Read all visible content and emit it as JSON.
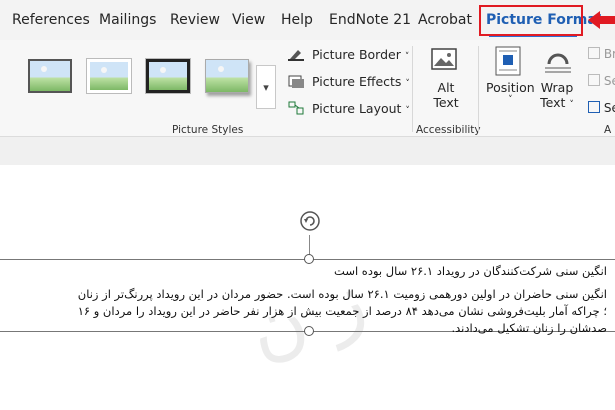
{
  "tabs": [
    "References",
    "Mailings",
    "Review",
    "View",
    "Help",
    "EndNote 21",
    "Acrobat",
    "Picture Format"
  ],
  "active_tab": "Picture Format",
  "annotation": {
    "highlight_color": "#e01a22"
  },
  "ribbon": {
    "picture_styles": {
      "label": "Picture Styles",
      "commands": {
        "border": "Picture Border",
        "effects": "Picture Effects",
        "layout": "Picture Layout"
      }
    },
    "accessibility": {
      "label": "Accessibility",
      "alt_text_line1": "Alt",
      "alt_text_line2": "Text"
    },
    "arrange": {
      "position": "Position",
      "wrap_line1": "Wrap",
      "wrap_line2": "Text",
      "partial_cut_1": "Br",
      "partial_cut_2": "Se",
      "partial_cut_3": "Se",
      "group_label_partial": "A"
    }
  },
  "document": {
    "rtl_lines": [
      "انگین سنی شرکت‌کنندگان در رویداد ۲۶.۱ سال بوده است",
      "انگین سنی حاضران در اولین دورهمی زومیت ۲۶.۱ سال بوده است. حضور مردان در این رویداد پررنگ‌تر از زنان",
      "؛ چراکه آمار بلیت‌فروشی نشان می‌دهد ۸۴ درصد از جمعیت بیش از هزار نفر حاضر در این رویداد را مردان و ۱۶",
      "صدشان را زنان تشکیل می‌دادند."
    ],
    "watermark_text": "ز ن"
  }
}
